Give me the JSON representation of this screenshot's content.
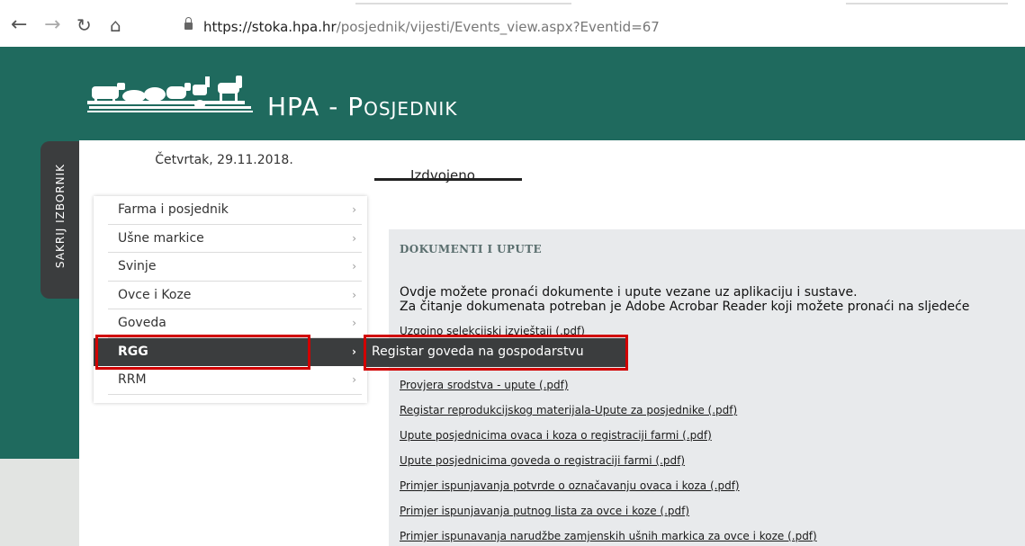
{
  "browser": {
    "url_domain": "https://stoka.hpa.hr",
    "url_path": "/posjednik/vijesti/Events_view.aspx?Eventid=67"
  },
  "header": {
    "site_title": "HPA - Posjednik"
  },
  "sidebar": {
    "hide_menu_label": "SAKRIJ IZBORNIK",
    "date": "Četvrtak, 29.11.2018.",
    "items": [
      {
        "label": "Farma i posjednik"
      },
      {
        "label": "Ušne markice"
      },
      {
        "label": "Svinje"
      },
      {
        "label": "Ovce i Koze"
      },
      {
        "label": "Goveda"
      },
      {
        "label": "RGG",
        "active": true
      },
      {
        "label": "RRM"
      }
    ],
    "submenu": {
      "label": "Registar goveda na gospodarstvu"
    }
  },
  "main": {
    "tab_label": "Izdvojeno",
    "panel_title": "DOKUMENTI I UPUTE",
    "intro_line1": "Ovdje možete pronaći dokumente i upute vezane uz aplikaciju i sustave.",
    "intro_line2": "Za čitanje dokumenata potreban je Adobe Acrobar Reader koji možete pronaći na sljedeće",
    "documents": [
      {
        "label": "Uzgojno selekcijski izvještaji (.pdf)"
      },
      {
        "label": "Provjera srodstva - upute (.pdf)"
      },
      {
        "label": "Registar reprodukcijskog materijala-Upute za posjednike (.pdf)"
      },
      {
        "label": "Upute posjednicima ovaca i koza o registraciji farmi (.pdf)"
      },
      {
        "label": "Upute posjednicima goveda o registraciji farmi (.pdf)"
      },
      {
        "label": "Primjer ispunjavanja potvrde o označavanju ovaca i koza (.pdf)"
      },
      {
        "label": "Primjer ispunjavanja putnog lista za ovce i koze (.pdf)"
      },
      {
        "label": "Primjer ispunavanja narudžbe zamjenskih ušnih markica za ovce i koze (.pdf)"
      }
    ]
  },
  "colors": {
    "header_teal": "#1f6a5e",
    "menu_dark": "#3b3d3e",
    "highlight_red": "#d10000"
  }
}
